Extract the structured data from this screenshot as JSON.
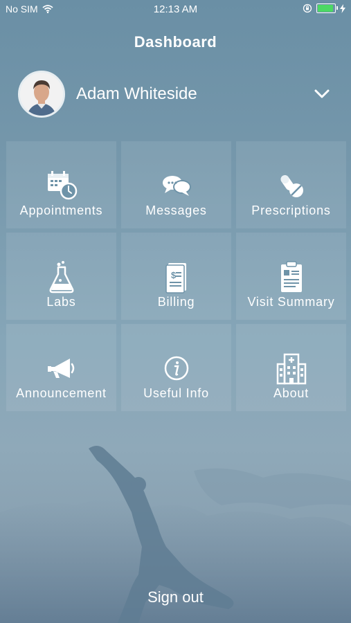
{
  "status": {
    "carrier": "No SIM",
    "time": "12:13 AM",
    "battery_color": "#4cd964"
  },
  "header": {
    "title": "Dashboard"
  },
  "user": {
    "name": "Adam Whiteside"
  },
  "tiles": [
    {
      "label": "Appointments",
      "icon": "calendar-clock-icon"
    },
    {
      "label": "Messages",
      "icon": "chat-bubbles-icon"
    },
    {
      "label": "Prescriptions",
      "icon": "pills-icon"
    },
    {
      "label": "Labs",
      "icon": "flask-icon"
    },
    {
      "label": "Billing",
      "icon": "bill-icon"
    },
    {
      "label": "Visit Summary",
      "icon": "clipboard-icon"
    },
    {
      "label": "Announcement",
      "icon": "megaphone-icon"
    },
    {
      "label": "Useful Info",
      "icon": "info-icon"
    },
    {
      "label": "About",
      "icon": "hospital-icon"
    }
  ],
  "footer": {
    "signout_label": "Sign out"
  }
}
